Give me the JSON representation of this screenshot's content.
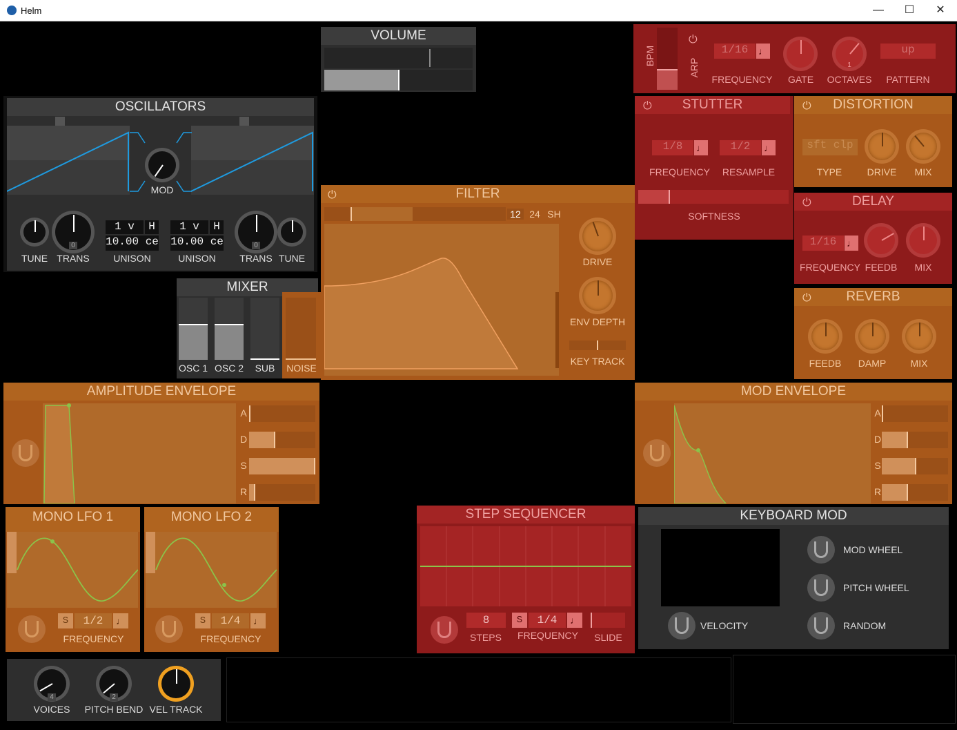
{
  "window": {
    "title": "Helm",
    "minimize": "—",
    "maximize": "☐",
    "close": "✕"
  },
  "volume": {
    "title": "VOLUME",
    "level": 0.5
  },
  "oscillators": {
    "title": "OSCILLATORS",
    "mod_label": "MOD",
    "osc1": {
      "tune": "TUNE",
      "trans": "TRANS",
      "trans_value": "0",
      "unison": "UNISON",
      "voices": "1 v",
      "harmonize": "H",
      "detune": "10.00 ce"
    },
    "osc2": {
      "tune": "TUNE",
      "trans": "TRANS",
      "trans_value": "0",
      "unison": "UNISON",
      "voices": "1 v",
      "harmonize": "H",
      "detune": "10.00 ce"
    }
  },
  "mixer": {
    "title": "MIXER",
    "channels": [
      {
        "label": "OSC 1",
        "level": 0.6
      },
      {
        "label": "OSC 2",
        "level": 0.6
      },
      {
        "label": "SUB",
        "level": 0.0
      },
      {
        "label": "NOISE",
        "level": 0.0
      }
    ]
  },
  "filter": {
    "title": "FILTER",
    "slopes": [
      "12",
      "24",
      "SH"
    ],
    "active_slope": "12",
    "drive": "DRIVE",
    "env_depth": "ENV DEPTH",
    "key_track": "KEY TRACK"
  },
  "arp": {
    "bpm": "BPM",
    "arp": "ARP",
    "frequency_value": "1/16",
    "frequency": "FREQUENCY",
    "gate": "GATE",
    "octaves": "OCTAVES",
    "octaves_value": "1",
    "pattern_value": "up",
    "pattern": "PATTERN"
  },
  "stutter": {
    "title": "STUTTER",
    "frequency_value": "1/8",
    "frequency": "FREQUENCY",
    "resample_value": "1/2",
    "resample": "RESAMPLE",
    "softness": "SOFTNESS"
  },
  "distortion": {
    "title": "DISTORTION",
    "type_value": "sft clp",
    "type": "TYPE",
    "drive": "DRIVE",
    "mix": "MIX"
  },
  "delay": {
    "title": "DELAY",
    "frequency_value": "1/16",
    "frequency": "FREQUENCY",
    "feedb": "FEEDB",
    "mix": "MIX"
  },
  "reverb": {
    "title": "REVERB",
    "feedb": "FEEDB",
    "damp": "DAMP",
    "mix": "MIX"
  },
  "amp_env": {
    "title": "AMPLITUDE ENVELOPE",
    "a": "A",
    "d": "D",
    "s": "S",
    "r": "R",
    "a_level": 0.02,
    "d_level": 0.3,
    "s_level": 1.0,
    "r_level": 0.06
  },
  "mod_env": {
    "title": "MOD ENVELOPE",
    "a": "A",
    "d": "D",
    "s": "S",
    "r": "R",
    "a_level": 0.02,
    "d_level": 0.4,
    "s_level": 0.55,
    "r_level": 0.4
  },
  "lfo1": {
    "title": "MONO LFO 1",
    "sync": "S",
    "value": "1/2",
    "frequency": "FREQUENCY"
  },
  "lfo2": {
    "title": "MONO LFO 2",
    "sync": "S",
    "value": "1/4",
    "frequency": "FREQUENCY"
  },
  "step_seq": {
    "title": "STEP SEQUENCER",
    "steps_value": "8",
    "steps": "STEPS",
    "sync": "S",
    "frequency_value": "1/4",
    "frequency": "FREQUENCY",
    "slide": "SLIDE"
  },
  "keyboard_mod": {
    "title": "KEYBOARD MOD",
    "velocity": "VELOCITY",
    "mod_wheel": "MOD WHEEL",
    "pitch_wheel": "PITCH WHEEL",
    "random": "RANDOM"
  },
  "global": {
    "voices": "VOICES",
    "voices_value": "4",
    "pitch_bend": "PITCH BEND",
    "pitch_bend_value": "2",
    "vel_track": "VEL TRACK"
  },
  "colors": {
    "accent_blue": "#1e9be0",
    "accent_green": "#8bc34a",
    "orange_panel": "#a8581a",
    "red_panel": "#8e1b1b",
    "gray_panel": "#2e2e2e",
    "knob_amber": "#f0a020"
  }
}
